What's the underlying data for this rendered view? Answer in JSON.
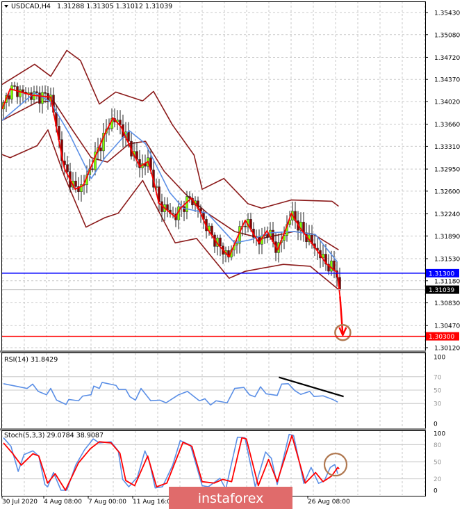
{
  "header": {
    "symbol": "USDCAD,H4",
    "ohlc": "1.31288 1.31305 1.31012 1.31039"
  },
  "logo": "instaforex",
  "colors": {
    "blue_level": "#0000ff",
    "red_level": "#ff0000",
    "fast_ma": "#ff0000",
    "slow_ma": "#5b8fe6",
    "bands": "#8b1a1a",
    "bull": "#7fff00",
    "bear": "#8b0000",
    "annotation": "#b07850",
    "rsi": "#5b8fe6",
    "stoch_main": "#5b8fe6",
    "stoch_signal": "#ff0000"
  },
  "chart_data": [
    {
      "type": "line",
      "title": "USDCAD,H4",
      "x_unit": "H4 bar index",
      "ylim": [
        1.3012,
        1.3543
      ],
      "price_ticks": [
        "1.35430",
        "1.35080",
        "1.34720",
        "1.34370",
        "1.34020",
        "1.33660",
        "1.33310",
        "1.32950",
        "1.32600",
        "1.32240",
        "1.31890",
        "1.31530",
        "1.31180",
        "1.30830",
        "1.30470",
        "1.30120"
      ],
      "levels": [
        {
          "name": "support-level-blue",
          "price": 1.313,
          "label": "1.31300",
          "color": "#0000ff"
        },
        {
          "name": "target-level-red",
          "price": 1.303,
          "label": "1.30300",
          "color": "#ff0000"
        }
      ],
      "current_price": {
        "price": 1.31039,
        "label": "1.31039"
      },
      "time_labels": [
        {
          "x": 0,
          "label": "30 Jul 2020"
        },
        {
          "x": 15,
          "label": "4 Aug 08:00"
        },
        {
          "x": 31,
          "label": "7 Aug 00:00"
        },
        {
          "x": 47,
          "label": "11 Aug 16:00"
        },
        {
          "x": 110,
          "label": "26 Aug 08:00"
        }
      ],
      "series": [
        {
          "name": "fast-ma",
          "points": [
            [
              0,
              1.339
            ],
            [
              2.9,
              1.3422
            ],
            [
              10.7,
              1.3412
            ],
            [
              17.5,
              1.3409
            ],
            [
              19.5,
              1.3362
            ],
            [
              22.4,
              1.3296
            ],
            [
              26.3,
              1.3263
            ],
            [
              29.2,
              1.3269
            ],
            [
              33.1,
              1.331
            ],
            [
              37,
              1.3351
            ],
            [
              39.9,
              1.3376
            ],
            [
              42.8,
              1.3362
            ],
            [
              46.7,
              1.3324
            ],
            [
              49.6,
              1.3299
            ],
            [
              52.5,
              1.3307
            ],
            [
              54.5,
              1.3277
            ],
            [
              56.4,
              1.3241
            ],
            [
              62.3,
              1.3219
            ],
            [
              64.2,
              1.3233
            ],
            [
              68.1,
              1.3249
            ],
            [
              71,
              1.323
            ],
            [
              73.9,
              1.32
            ],
            [
              77.8,
              1.3175
            ],
            [
              81.7,
              1.3156
            ],
            [
              84.6,
              1.3186
            ],
            [
              87.5,
              1.3214
            ],
            [
              92.4,
              1.3178
            ],
            [
              95.3,
              1.3197
            ],
            [
              99.2,
              1.3167
            ],
            [
              102.1,
              1.32
            ],
            [
              104.1,
              1.3225
            ],
            [
              107,
              1.3203
            ],
            [
              111.9,
              1.3175
            ],
            [
              116.7,
              1.3145
            ],
            [
              120.6,
              1.3131
            ],
            [
              121.6,
              1.3093
            ]
          ]
        },
        {
          "name": "slow-ma",
          "points": [
            [
              0,
              1.3372
            ],
            [
              11.7,
              1.3416
            ],
            [
              17.5,
              1.3401
            ],
            [
              24.3,
              1.335
            ],
            [
              32.1,
              1.328
            ],
            [
              37,
              1.3313
            ],
            [
              45.7,
              1.3356
            ],
            [
              51.6,
              1.3335
            ],
            [
              60.3,
              1.3258
            ],
            [
              65.2,
              1.3233
            ],
            [
              73.9,
              1.3225
            ],
            [
              83.7,
              1.3178
            ],
            [
              89.5,
              1.3183
            ],
            [
              96.3,
              1.3194
            ],
            [
              105.1,
              1.3196
            ],
            [
              112.8,
              1.3191
            ],
            [
              120.6,
              1.3148
            ]
          ]
        },
        {
          "name": "bollinger-upper",
          "points": [
            [
              0,
              1.3429
            ],
            [
              11.7,
              1.3461
            ],
            [
              17.5,
              1.3442
            ],
            [
              23.3,
              1.3483
            ],
            [
              28.2,
              1.3467
            ],
            [
              35,
              1.3398
            ],
            [
              40.9,
              1.3417
            ],
            [
              50.6,
              1.3403
            ],
            [
              54.5,
              1.3418
            ],
            [
              61.3,
              1.3365
            ],
            [
              69.1,
              1.3317
            ],
            [
              72,
              1.3263
            ],
            [
              79.8,
              1.328
            ],
            [
              88.5,
              1.324
            ],
            [
              93.4,
              1.3233
            ],
            [
              104.1,
              1.3246
            ],
            [
              118.7,
              1.3244
            ],
            [
              121.1,
              1.3236
            ]
          ]
        },
        {
          "name": "bollinger-middle",
          "points": [
            [
              0,
              1.3372
            ],
            [
              12.6,
              1.3401
            ],
            [
              18.5,
              1.3403
            ],
            [
              25.3,
              1.3357
            ],
            [
              32.1,
              1.3313
            ],
            [
              37.9,
              1.3306
            ],
            [
              45.7,
              1.3335
            ],
            [
              51.6,
              1.3339
            ],
            [
              58.4,
              1.3291
            ],
            [
              66.1,
              1.3255
            ],
            [
              73.9,
              1.3225
            ],
            [
              83.7,
              1.3196
            ],
            [
              93.4,
              1.3185
            ],
            [
              105.1,
              1.3196
            ],
            [
              111.9,
              1.3192
            ],
            [
              121.1,
              1.3167
            ]
          ]
        },
        {
          "name": "bollinger-lower",
          "points": [
            [
              0,
              1.3318
            ],
            [
              2.9,
              1.3313
            ],
            [
              12.6,
              1.3332
            ],
            [
              16.5,
              1.3357
            ],
            [
              22.4,
              1.3284
            ],
            [
              30.2,
              1.3203
            ],
            [
              37,
              1.3218
            ],
            [
              41.8,
              1.3225
            ],
            [
              50.6,
              1.3277
            ],
            [
              62.3,
              1.3178
            ],
            [
              70,
              1.3185
            ],
            [
              81.7,
              1.3122
            ],
            [
              87.5,
              1.3133
            ],
            [
              101.2,
              1.3144
            ],
            [
              110.9,
              1.3141
            ],
            [
              121.1,
              1.3104
            ]
          ]
        }
      ],
      "forecast_arrow": {
        "from": [
          121.6,
          1.3093
        ],
        "to": [
          122.6,
          1.3032
        ]
      },
      "target_circle": {
        "x": 122.6,
        "price": 1.3036
      }
    },
    {
      "type": "line",
      "title": "RSI(14) 31.8429",
      "ylim": [
        0,
        100
      ],
      "ticks": [
        "100",
        "70",
        "50",
        "30",
        "0"
      ],
      "series": [
        {
          "name": "rsi",
          "points": [
            [
              0.5,
              59.6
            ],
            [
              6,
              55
            ],
            [
              9,
              52.5
            ],
            [
              11,
              59
            ],
            [
              13,
              48
            ],
            [
              16,
              43
            ],
            [
              17.5,
              52.5
            ],
            [
              19.6,
              35
            ],
            [
              23,
              28.5
            ],
            [
              24,
              36
            ],
            [
              27.5,
              34
            ],
            [
              29,
              41
            ],
            [
              32,
              43
            ],
            [
              33,
              56
            ],
            [
              35,
              52.5
            ],
            [
              36,
              61.5
            ],
            [
              41,
              57
            ],
            [
              42,
              51
            ],
            [
              44.5,
              51
            ],
            [
              46,
              40
            ],
            [
              48,
              35
            ],
            [
              50,
              52.5
            ],
            [
              53.5,
              34
            ],
            [
              56.7,
              35
            ],
            [
              59,
              31
            ],
            [
              63.5,
              43
            ],
            [
              66.7,
              48
            ],
            [
              71,
              34
            ],
            [
              73,
              37
            ],
            [
              75,
              27.6
            ],
            [
              77,
              34
            ],
            [
              81,
              31
            ],
            [
              83.7,
              52.5
            ],
            [
              87,
              54
            ],
            [
              89,
              43
            ],
            [
              91,
              40
            ],
            [
              93,
              55
            ],
            [
              95,
              44.5
            ],
            [
              99,
              42
            ],
            [
              100.6,
              59
            ],
            [
              103,
              59.6
            ],
            [
              105.4,
              49
            ],
            [
              107.5,
              43.6
            ],
            [
              110.7,
              48
            ],
            [
              112.3,
              40.4
            ],
            [
              115.5,
              41.4
            ],
            [
              119,
              36
            ],
            [
              120.8,
              32
            ]
          ]
        }
      ],
      "trendline": {
        "from": [
          99.6,
          69.2
        ],
        "to": [
          122.9,
          40.4
        ]
      }
    },
    {
      "type": "line",
      "title": "Stoch(5,3,3) 29.0784 38.9087",
      "ylim": [
        0,
        100
      ],
      "ticks": [
        "100",
        "80",
        "50",
        "20",
        "0"
      ],
      "series": [
        {
          "name": "stoch-main",
          "points": [
            [
              0.5,
              92
            ],
            [
              3.2,
              77
            ],
            [
              5.8,
              33
            ],
            [
              7.9,
              62.5
            ],
            [
              11.1,
              69
            ],
            [
              13.2,
              60
            ],
            [
              15.4,
              10
            ],
            [
              16.4,
              6
            ],
            [
              18.5,
              31
            ],
            [
              21.2,
              0
            ],
            [
              23.3,
              0
            ],
            [
              26.5,
              44
            ],
            [
              29.7,
              71
            ],
            [
              32.8,
              90
            ],
            [
              35,
              83
            ],
            [
              39.2,
              85
            ],
            [
              41.8,
              69
            ],
            [
              43.4,
              19
            ],
            [
              45.6,
              6
            ],
            [
              48.7,
              23
            ],
            [
              51.4,
              69
            ],
            [
              53,
              50
            ],
            [
              55.1,
              4
            ],
            [
              57.7,
              6
            ],
            [
              61.4,
              44
            ],
            [
              64.1,
              87
            ],
            [
              67.8,
              79
            ],
            [
              72,
              8
            ],
            [
              74.2,
              6
            ],
            [
              78.4,
              21
            ],
            [
              80.5,
              2
            ],
            [
              84.7,
              93
            ],
            [
              87.4,
              92
            ],
            [
              91.1,
              6
            ],
            [
              94.8,
              67
            ],
            [
              96.9,
              56
            ],
            [
              99,
              10
            ],
            [
              103.3,
              98
            ],
            [
              104.9,
              96
            ],
            [
              108.6,
              12
            ],
            [
              111.2,
              40
            ],
            [
              113.9,
              12
            ],
            [
              116,
              17
            ],
            [
              118.1,
              40
            ],
            [
              119.7,
              45
            ],
            [
              120.8,
              29
            ]
          ]
        },
        {
          "name": "stoch-signal",
          "points": [
            [
              0.5,
              83
            ],
            [
              3.7,
              65
            ],
            [
              6.9,
              44
            ],
            [
              11.1,
              64
            ],
            [
              13.2,
              60
            ],
            [
              16.4,
              12.5
            ],
            [
              19.1,
              29
            ],
            [
              22.8,
              0
            ],
            [
              27.5,
              48
            ],
            [
              31.8,
              73
            ],
            [
              35,
              85
            ],
            [
              39.2,
              83
            ],
            [
              42.4,
              65
            ],
            [
              44.5,
              17
            ],
            [
              47.7,
              8
            ],
            [
              52.4,
              60
            ],
            [
              55.6,
              6
            ],
            [
              59.3,
              12.5
            ],
            [
              65.1,
              84
            ],
            [
              68.3,
              77
            ],
            [
              72,
              15
            ],
            [
              76.3,
              12.5
            ],
            [
              79.4,
              19
            ],
            [
              82.6,
              15
            ],
            [
              86.3,
              92
            ],
            [
              87.9,
              90
            ],
            [
              92.2,
              8
            ],
            [
              95.9,
              54
            ],
            [
              99,
              15
            ],
            [
              104.3,
              96
            ],
            [
              109.1,
              12.5
            ],
            [
              112.8,
              31
            ],
            [
              115.5,
              15
            ],
            [
              118.6,
              25
            ],
            [
              120.8,
              40
            ],
            [
              121.3,
              37.5
            ]
          ]
        }
      ],
      "annotation_circle": {
        "x": 120,
        "value": 45
      }
    }
  ]
}
